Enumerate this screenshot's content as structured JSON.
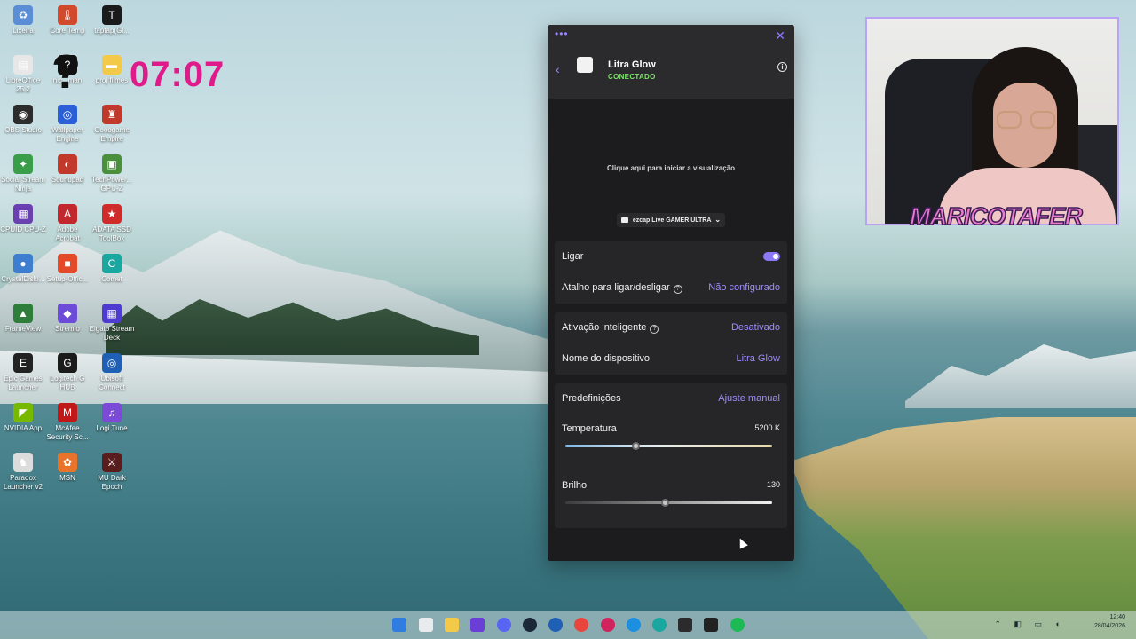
{
  "desktop": {
    "clock": "07:07",
    "icons": [
      {
        "label": "Lixeira",
        "color": "#5b8dd6",
        "glyph": "♻"
      },
      {
        "label": "Core Temp",
        "color": "#d24a2e",
        "glyph": "🌡"
      },
      {
        "label": "taptap(Gl...",
        "color": "#1a1a1a",
        "glyph": "T"
      },
      {
        "label": "LibreOffice 25.2",
        "color": "#e7e7e7",
        "glyph": "▤"
      },
      {
        "label": "nic...man",
        "color": "#111111",
        "glyph": "?"
      },
      {
        "label": "proj filmes",
        "color": "#f3c94a",
        "glyph": "▬"
      },
      {
        "label": "OBS Studio",
        "color": "#2c2c2c",
        "glyph": "◉"
      },
      {
        "label": "Wallpaper Engine",
        "color": "#2a5fd8",
        "glyph": "◎"
      },
      {
        "label": "Goodgame Empire",
        "color": "#c0392b",
        "glyph": "♜"
      },
      {
        "label": "Social Stream Ninja",
        "color": "#3a9d4a",
        "glyph": "✦"
      },
      {
        "label": "Soundpad",
        "color": "#c0392b",
        "glyph": "◐"
      },
      {
        "label": "TechPower... GPU-Z",
        "color": "#4b8f3c",
        "glyph": "▣"
      },
      {
        "label": "CPUID CPU-Z",
        "color": "#6a3fb0",
        "glyph": "▦"
      },
      {
        "label": "Adobe Acrobat",
        "color": "#c1272d",
        "glyph": "A"
      },
      {
        "label": "ADATA SSD ToolBox",
        "color": "#d02b2b",
        "glyph": "★"
      },
      {
        "label": "CrystalDiskI...",
        "color": "#3e7ed0",
        "glyph": "●"
      },
      {
        "label": "Setup-Offic...",
        "color": "#e34a2a",
        "glyph": "■"
      },
      {
        "label": "Comet",
        "color": "#19a7a0",
        "glyph": "C"
      },
      {
        "label": "FrameView",
        "color": "#2f7d3a",
        "glyph": "▲"
      },
      {
        "label": "Stremio",
        "color": "#6b4bd8",
        "glyph": "◆"
      },
      {
        "label": "Elgato Stream Deck",
        "color": "#4e3bd1",
        "glyph": "▦"
      },
      {
        "label": "Epic Games Launcher",
        "color": "#222222",
        "glyph": "E"
      },
      {
        "label": "Logitech G HUB",
        "color": "#1a1a1a",
        "glyph": "G"
      },
      {
        "label": "Ubisoft Connect",
        "color": "#1f5fb4",
        "glyph": "◎"
      },
      {
        "label": "NVIDIA App",
        "color": "#76b900",
        "glyph": "◤"
      },
      {
        "label": "McAfee Security Sc...",
        "color": "#c01818",
        "glyph": "M"
      },
      {
        "label": "Logi Tune",
        "color": "#7b4bd8",
        "glyph": "♫"
      },
      {
        "label": "Paradox Launcher v2",
        "color": "#dcdcdc",
        "glyph": "♞"
      },
      {
        "label": "MSN",
        "color": "#e8732a",
        "glyph": "✿"
      },
      {
        "label": "MU Dark Epoch",
        "color": "#5a1d1d",
        "glyph": "⚔"
      }
    ]
  },
  "logi_tune": {
    "device_name": "Litra Glow",
    "device_status": "CONECTADO",
    "preview_hint": "Clique aqui para iniciar a visualização",
    "camera_select": "ezcap Live GAMER ULTRA",
    "power": {
      "label": "Ligar",
      "on": true
    },
    "shortcut": {
      "label": "Atalho para ligar/desligar",
      "value": "Não configurado"
    },
    "smart_activation": {
      "label": "Ativação inteligente",
      "value": "Desativado"
    },
    "device_name_row": {
      "label": "Nome do dispositivo",
      "value": "Litra Glow"
    },
    "presets": {
      "label": "Predefinições",
      "value": "Ajuste manual"
    },
    "temperature": {
      "label": "Temperatura",
      "value": "5200 K",
      "fraction": 0.34
    },
    "brightness": {
      "label": "Brilho",
      "value": "130",
      "fraction": 0.48
    },
    "accent_color": "#9f8cff",
    "status_color": "#7ee36b"
  },
  "overlay": {
    "streamer_name": "MARICOTAFER"
  },
  "taskbar": {
    "time": "12:40",
    "date": "28/04/2026"
  }
}
